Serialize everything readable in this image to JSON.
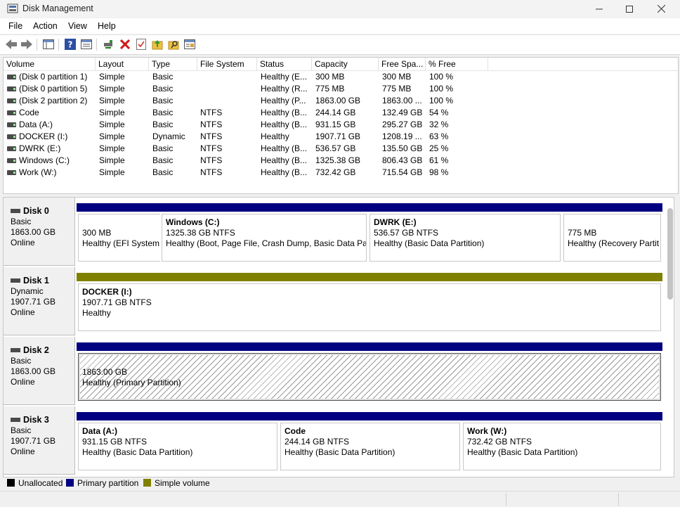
{
  "window": {
    "title": "Disk Management"
  },
  "menu": [
    "File",
    "Action",
    "View",
    "Help"
  ],
  "toolbar": {
    "icons": [
      "back-icon",
      "forward-icon",
      "show-hide-console-tree-icon",
      "help-icon",
      "properties-icon",
      "connect-icon",
      "delete-icon",
      "check-icon",
      "folder-up-icon",
      "search-folder-icon",
      "export-list-icon"
    ]
  },
  "volumes": {
    "columns": [
      "Volume",
      "Layout",
      "Type",
      "File System",
      "Status",
      "Capacity",
      "Free Spa...",
      "% Free"
    ],
    "rows": [
      [
        "(Disk 0 partition 1)",
        "Simple",
        "Basic",
        "",
        "Healthy (E...",
        "300 MB",
        "300 MB",
        "100 %"
      ],
      [
        "(Disk 0 partition 5)",
        "Simple",
        "Basic",
        "",
        "Healthy (R...",
        "775 MB",
        "775 MB",
        "100 %"
      ],
      [
        "(Disk 2 partition 2)",
        "Simple",
        "Basic",
        "",
        "Healthy (P...",
        "1863.00 GB",
        "1863.00 ...",
        "100 %"
      ],
      [
        "Code",
        "Simple",
        "Basic",
        "NTFS",
        "Healthy (B...",
        "244.14 GB",
        "132.49 GB",
        "54 %"
      ],
      [
        "Data (A:)",
        "Simple",
        "Basic",
        "NTFS",
        "Healthy (B...",
        "931.15 GB",
        "295.27 GB",
        "32 %"
      ],
      [
        "DOCKER (I:)",
        "Simple",
        "Dynamic",
        "NTFS",
        "Healthy",
        "1907.71 GB",
        "1208.19 ...",
        "63 %"
      ],
      [
        "DWRK (E:)",
        "Simple",
        "Basic",
        "NTFS",
        "Healthy (B...",
        "536.57 GB",
        "135.50 GB",
        "25 %"
      ],
      [
        "Windows (C:)",
        "Simple",
        "Basic",
        "NTFS",
        "Healthy (B...",
        "1325.38 GB",
        "806.43 GB",
        "61 %"
      ],
      [
        "Work (W:)",
        "Simple",
        "Basic",
        "NTFS",
        "Healthy (B...",
        "732.42 GB",
        "715.54 GB",
        "98 %"
      ]
    ]
  },
  "disks": [
    {
      "name": "Disk 0",
      "type": "Basic",
      "size": "1863.00 GB",
      "state": "Online",
      "partitions": [
        {
          "title": "",
          "size": "300 MB",
          "status": "Healthy (EFI System",
          "color": "#000080",
          "style": "plain"
        },
        {
          "title": "Windows  (C:)",
          "size": "1325.38 GB NTFS",
          "status": "Healthy (Boot, Page File, Crash Dump, Basic Data Part",
          "color": "#000080",
          "style": "plain"
        },
        {
          "title": "DWRK  (E:)",
          "size": "536.57 GB NTFS",
          "status": "Healthy (Basic Data Partition)",
          "color": "#000080",
          "style": "plain"
        },
        {
          "title": "",
          "size": "775 MB",
          "status": "Healthy (Recovery Partit",
          "color": "#000080",
          "style": "plain"
        }
      ]
    },
    {
      "name": "Disk 1",
      "type": "Dynamic",
      "size": "1907.71 GB",
      "state": "Online",
      "partitions": [
        {
          "title": "DOCKER  (I:)",
          "size": "1907.71 GB NTFS",
          "status": "Healthy",
          "color": "#808000",
          "style": "plain"
        }
      ]
    },
    {
      "name": "Disk 2",
      "type": "Basic",
      "size": "1863.00 GB",
      "state": "Online",
      "partitions": [
        {
          "title": "",
          "size": "1863.00 GB",
          "status": "Healthy (Primary Partition)",
          "color": "#000080",
          "style": "hatched"
        }
      ]
    },
    {
      "name": "Disk 3",
      "type": "Basic",
      "size": "1907.71 GB",
      "state": "Online",
      "partitions": [
        {
          "title": "Data  (A:)",
          "size": "931.15 GB NTFS",
          "status": "Healthy (Basic Data Partition)",
          "color": "#000080",
          "style": "plain"
        },
        {
          "title": "Code",
          "size": "244.14 GB NTFS",
          "status": "Healthy (Basic Data Partition)",
          "color": "#000080",
          "style": "plain"
        },
        {
          "title": "Work  (W:)",
          "size": "732.42 GB NTFS",
          "status": "Healthy (Basic Data Partition)",
          "color": "#000080",
          "style": "plain"
        }
      ]
    }
  ],
  "legend": [
    {
      "label": "Unallocated",
      "color": "#000000"
    },
    {
      "label": "Primary partition",
      "color": "#000080"
    },
    {
      "label": "Simple volume",
      "color": "#808000"
    }
  ]
}
